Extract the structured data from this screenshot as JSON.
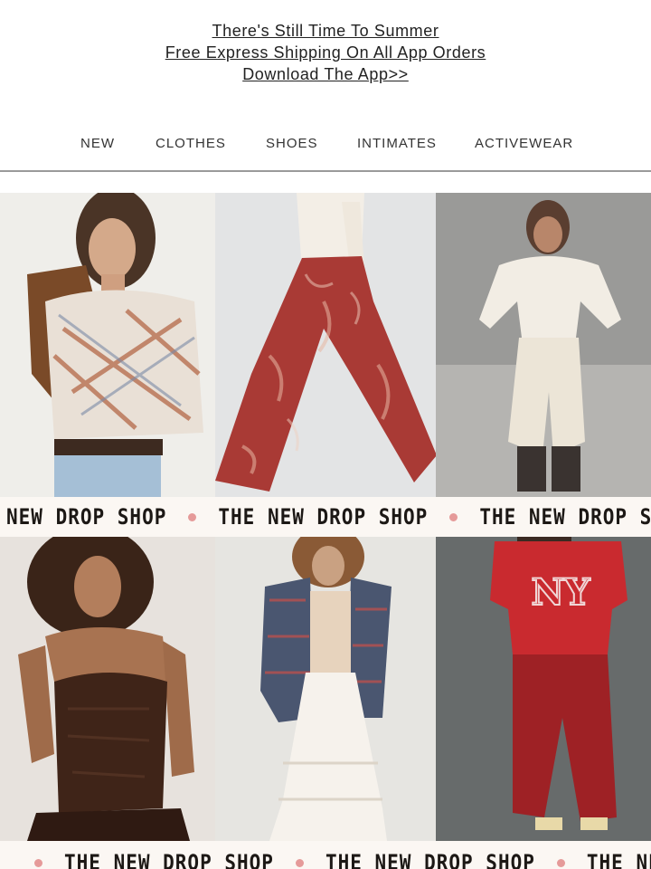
{
  "promo": {
    "line1": "There's Still Time To Summer",
    "line2": "Free Express Shipping On All App Orders",
    "line3": "Download The App>>"
  },
  "nav": {
    "items": [
      "NEW",
      "CLOTHES",
      "SHOES",
      "INTIMATES",
      "ACTIVEWEAR"
    ]
  },
  "ticker": {
    "text": "THE NEW DROP SHOP",
    "row1_lead": "NEW DROP SHOP",
    "dot_color": "#e59a99"
  },
  "products": [
    {
      "icon": "model-plaid-cardigan-image"
    },
    {
      "icon": "model-red-paisley-wide-pants-image"
    },
    {
      "icon": "model-cream-cargo-set-image"
    },
    {
      "icon": "model-brown-lace-corset-image"
    },
    {
      "icon": "model-plaid-shirt-white-skirt-image"
    },
    {
      "icon": "model-red-ny-sweatsuit-image"
    }
  ]
}
